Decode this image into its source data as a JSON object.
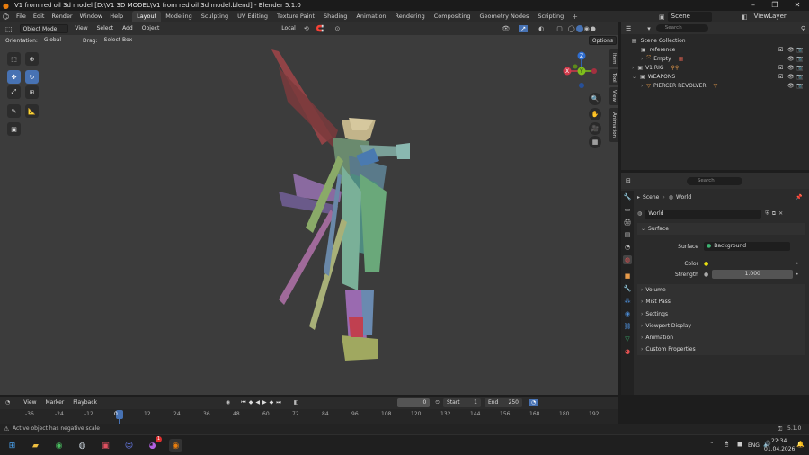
{
  "window": {
    "title": "V1 from red oil 3d model [D:\\V1 3D MODEL\\V1 from red oil 3d model.blend] - Blender 5.1.0"
  },
  "menu": [
    "File",
    "Edit",
    "Render",
    "Window",
    "Help"
  ],
  "workspaces": [
    "Layout",
    "Modeling",
    "Sculpting",
    "UV Editing",
    "Texture Paint",
    "Shading",
    "Animation",
    "Rendering",
    "Compositing",
    "Geometry Nodes",
    "Scripting"
  ],
  "scene": {
    "name": "Scene",
    "view_layer": "ViewLayer"
  },
  "viewport": {
    "mode": "Object Mode",
    "menus": [
      "View",
      "Select",
      "Add",
      "Object"
    ],
    "transform_orientation": "Local",
    "orientation_label": "Orientation:",
    "orientation_value": "Global",
    "drag_label": "Drag:",
    "drag_value": "Select Box",
    "options_label": "Options",
    "nav_tabs": [
      "Item",
      "Tool",
      "View",
      "Animation"
    ],
    "gizmo_axes": [
      "Z",
      "X",
      "Y"
    ]
  },
  "outliner": {
    "search_placeholder": "Search",
    "root": "Scene Collection",
    "items": [
      {
        "name": "reference"
      },
      {
        "name": "Empty"
      },
      {
        "name": "V1 RIG"
      },
      {
        "name": "WEAPONS"
      },
      {
        "name": "PIERCER REVOLVER"
      }
    ]
  },
  "properties": {
    "search_placeholder": "Search",
    "breadcrumb": [
      "Scene",
      "World"
    ],
    "world_name": "World",
    "surface_header": "Surface",
    "surface_label": "Surface",
    "surface_value": "Background",
    "color_label": "Color",
    "strength_label": "Strength",
    "strength_value": "1.000",
    "panels": [
      "Volume",
      "Mist Pass",
      "Settings",
      "Viewport Display",
      "Animation",
      "Custom Properties"
    ]
  },
  "timeline": {
    "menus": [
      "View",
      "Marker",
      "Playback"
    ],
    "current_frame": "0",
    "start_label": "Start",
    "start_value": "1",
    "end_label": "End",
    "end_value": "250",
    "ruler": [
      "-36",
      "-24",
      "-12",
      "0",
      "12",
      "24",
      "36",
      "48",
      "60",
      "72",
      "84",
      "96",
      "108",
      "120",
      "132",
      "144",
      "156",
      "168",
      "180",
      "192"
    ]
  },
  "statusbar": {
    "message": "Active object has negative scale",
    "version": "5.1.0"
  },
  "taskbar": {
    "lang": "ENG",
    "time": "22:34",
    "date": "01.04.2026",
    "badge": "1"
  }
}
